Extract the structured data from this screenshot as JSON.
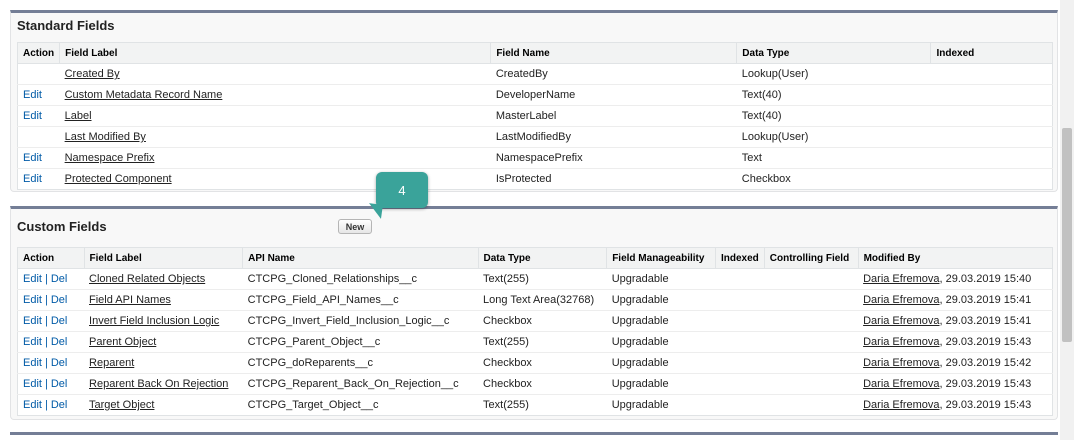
{
  "standard": {
    "title": "Standard Fields",
    "headers": [
      "Action",
      "Field Label",
      "Field Name",
      "Data Type",
      "Indexed"
    ],
    "rows": [
      {
        "action": "",
        "label": "Created By",
        "name": "CreatedBy",
        "type": "Lookup(User)",
        "indexed": ""
      },
      {
        "action": "Edit",
        "label": "Custom Metadata Record Name",
        "name": "DeveloperName",
        "type": "Text(40)",
        "indexed": ""
      },
      {
        "action": "Edit",
        "label": "Label",
        "name": "MasterLabel",
        "type": "Text(40)",
        "indexed": ""
      },
      {
        "action": "",
        "label": "Last Modified By",
        "name": "LastModifiedBy",
        "type": "Lookup(User)",
        "indexed": ""
      },
      {
        "action": "Edit",
        "label": "Namespace Prefix",
        "name": "NamespacePrefix",
        "type": "Text",
        "indexed": ""
      },
      {
        "action": "Edit",
        "label": "Protected Component",
        "name": "IsProtected",
        "type": "Checkbox",
        "indexed": ""
      }
    ]
  },
  "custom": {
    "title": "Custom Fields",
    "new_label": "New",
    "edit_label": "Edit",
    "del_label": "Del",
    "separator": "|",
    "headers": [
      "Action",
      "Field Label",
      "API Name",
      "Data Type",
      "Field Manageability",
      "Indexed",
      "Controlling Field",
      "Modified By"
    ],
    "rows": [
      {
        "label": "Cloned Related Objects",
        "api": "CTCPG_Cloned_Relationships__c",
        "type": "Text(255)",
        "manage": "Upgradable",
        "indexed": "",
        "controlling": "",
        "by": "Daria Efremova",
        "date": ", 29.03.2019 15:40"
      },
      {
        "label": "Field API Names",
        "api": "CTCPG_Field_API_Names__c",
        "type": "Long Text Area(32768)",
        "manage": "Upgradable",
        "indexed": "",
        "controlling": "",
        "by": "Daria Efremova",
        "date": ", 29.03.2019 15:41"
      },
      {
        "label": "Invert Field Inclusion Logic",
        "api": "CTCPG_Invert_Field_Inclusion_Logic__c",
        "type": "Checkbox",
        "manage": "Upgradable",
        "indexed": "",
        "controlling": "",
        "by": "Daria Efremova",
        "date": ", 29.03.2019 15:41"
      },
      {
        "label": "Parent Object",
        "api": "CTCPG_Parent_Object__c",
        "type": "Text(255)",
        "manage": "Upgradable",
        "indexed": "",
        "controlling": "",
        "by": "Daria Efremova",
        "date": ", 29.03.2019 15:43"
      },
      {
        "label": "Reparent",
        "api": "CTCPG_doReparents__c",
        "type": "Checkbox",
        "manage": "Upgradable",
        "indexed": "",
        "controlling": "",
        "by": "Daria Efremova",
        "date": ", 29.03.2019 15:42"
      },
      {
        "label": "Reparent Back On Rejection",
        "api": "CTCPG_Reparent_Back_On_Rejection__c",
        "type": "Checkbox",
        "manage": "Upgradable",
        "indexed": "",
        "controlling": "",
        "by": "Daria Efremova",
        "date": ", 29.03.2019 15:43"
      },
      {
        "label": "Target Object",
        "api": "CTCPG_Target_Object__c",
        "type": "Text(255)",
        "manage": "Upgradable",
        "indexed": "",
        "controlling": "",
        "by": "Daria Efremova",
        "date": ", 29.03.2019 15:43"
      }
    ]
  },
  "callout": {
    "number": "4"
  },
  "colors": {
    "accent": "#015ba7",
    "callout": "#3aa39a",
    "section_border": "#747e96"
  }
}
